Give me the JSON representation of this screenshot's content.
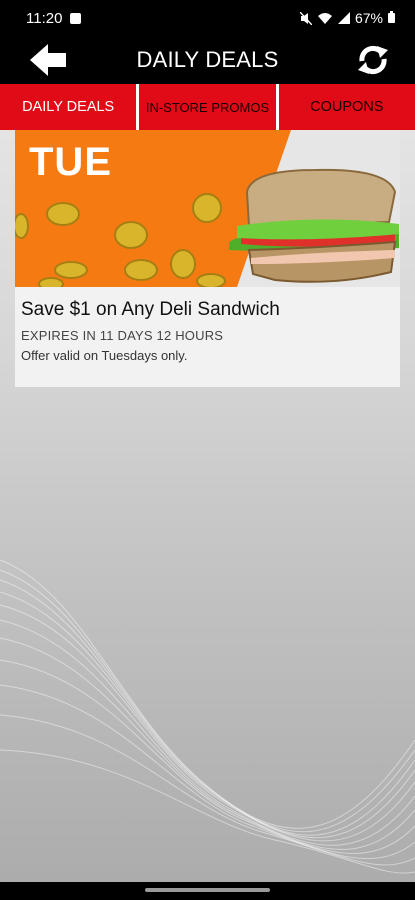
{
  "status": {
    "time": "11:20",
    "battery": "67%"
  },
  "app_bar": {
    "title": "DAILY DEALS"
  },
  "tabs": [
    {
      "label": "DAILY DEALS"
    },
    {
      "label": "IN-STORE PROMOS"
    },
    {
      "label": "COUPONS"
    }
  ],
  "deal": {
    "day": "TUE",
    "title": "Save $1 on Any Deli Sandwich",
    "expiry": "EXPIRES IN 11 DAYS 12 HOURS",
    "note": "Offer valid on Tuesdays only."
  },
  "colors": {
    "accent": "#e10b17",
    "banner_orange": "#f57a12"
  },
  "icons": [
    "back-arrow-icon",
    "refresh-icon",
    "sandwich-image",
    "coin-icon"
  ]
}
